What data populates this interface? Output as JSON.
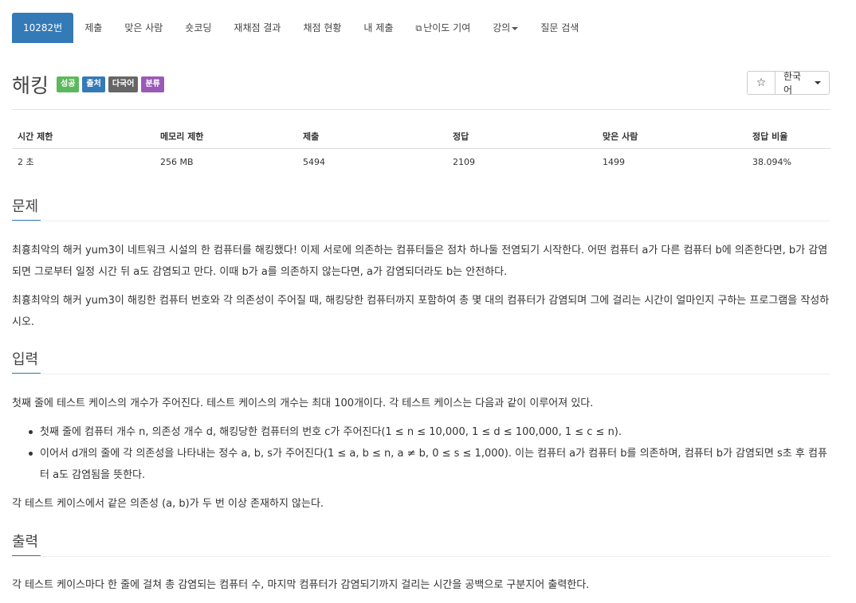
{
  "nav": {
    "items": [
      "10282번",
      "제출",
      "맞은 사람",
      "숏코딩",
      "재채점 결과",
      "채점 현황",
      "내 제출",
      "난이도 기여",
      "강의",
      "질문 검색"
    ]
  },
  "title": "해킹",
  "badges": [
    "성공",
    "출처",
    "다국어",
    "분류"
  ],
  "tools": {
    "star": "☆",
    "language": "한국어"
  },
  "stats": {
    "headers": [
      "시간 제한",
      "메모리 제한",
      "제출",
      "정답",
      "맞은 사람",
      "정답 비율"
    ],
    "values": [
      "2 초",
      "256 MB",
      "5494",
      "2109",
      "1499",
      "38.094%"
    ]
  },
  "sections": {
    "problem": {
      "heading": "문제",
      "p1": "최흉최악의 해커 yum3이 네트워크 시설의 한 컴퓨터를 해킹했다! 이제 서로에 의존하는 컴퓨터들은 점차 하나둘 전염되기 시작한다. 어떤 컴퓨터 a가 다른 컴퓨터 b에 의존한다면, b가 감염되면 그로부터 일정 시간 뒤 a도 감염되고 만다. 이때 b가 a를 의존하지 않는다면, a가 감염되더라도 b는 안전하다.",
      "p2": "최흉최악의 해커 yum3이 해킹한 컴퓨터 번호와 각 의존성이 주어질 때, 해킹당한 컴퓨터까지 포함하여 총 몇 대의 컴퓨터가 감염되며 그에 걸리는 시간이 얼마인지 구하는 프로그램을 작성하시오."
    },
    "input": {
      "heading": "입력",
      "p1": "첫째 줄에 테스트 케이스의 개수가 주어진다. 테스트 케이스의 개수는 최대 100개이다. 각 테스트 케이스는 다음과 같이 이루어져 있다.",
      "bullets": [
        "첫째 줄에 컴퓨터 개수 n, 의존성 개수 d, 해킹당한 컴퓨터의 번호 c가 주어진다(1 ≤ n ≤ 10,000, 1 ≤ d ≤ 100,000, 1 ≤ c ≤ n).",
        "이어서 d개의 줄에 각 의존성을 나타내는 정수 a, b, s가 주어진다(1 ≤ a, b ≤ n, a ≠ b, 0 ≤ s ≤ 1,000). 이는 컴퓨터 a가 컴퓨터 b를 의존하며, 컴퓨터 b가 감염되면 s초 후 컴퓨터 a도 감염됨을 뜻한다."
      ],
      "p2": "각 테스트 케이스에서 같은 의존성 (a, b)가 두 번 이상 존재하지 않는다."
    },
    "output": {
      "heading": "출력",
      "p1": "각 테스트 케이스마다 한 줄에 걸쳐 총 감염되는 컴퓨터 수, 마지막 컴퓨터가 감염되기까지 걸리는 시간을 공백으로 구분지어 출력한다."
    }
  },
  "colors": {
    "accent": "#337ab7",
    "success": "#5cb85c",
    "gray": "#666666",
    "purple": "#9b59b6"
  }
}
